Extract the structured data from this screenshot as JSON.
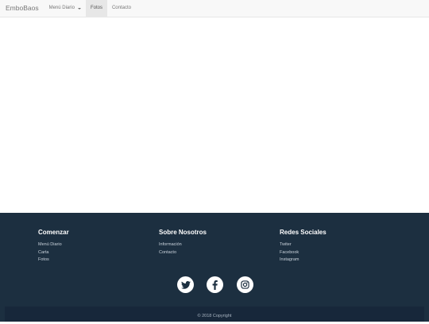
{
  "navbar": {
    "brand": "EmboBaos",
    "items": [
      {
        "label": "Menú Diario",
        "dropdown": true
      },
      {
        "label": "Fotos",
        "active": true
      },
      {
        "label": "Contacto"
      }
    ]
  },
  "footer": {
    "columns": [
      {
        "title": "Comenzar",
        "links": [
          "Menú Diario",
          "Carta",
          "Fotos"
        ]
      },
      {
        "title": "Sobre Nosotros",
        "links": [
          "Información",
          "Contacto"
        ]
      },
      {
        "title": "Redes Sociales",
        "links": [
          "Twiter",
          "Facebook",
          "Instagram"
        ]
      }
    ],
    "social_icons": [
      "twitter-icon",
      "facebook-icon",
      "instagram-icon"
    ],
    "copyright": "© 2018 Copyright"
  },
  "colors": {
    "navbar_bg": "#f8f8f8",
    "footer_bg": "#1c2f40",
    "footer_bottom_bg": "#17273a"
  }
}
